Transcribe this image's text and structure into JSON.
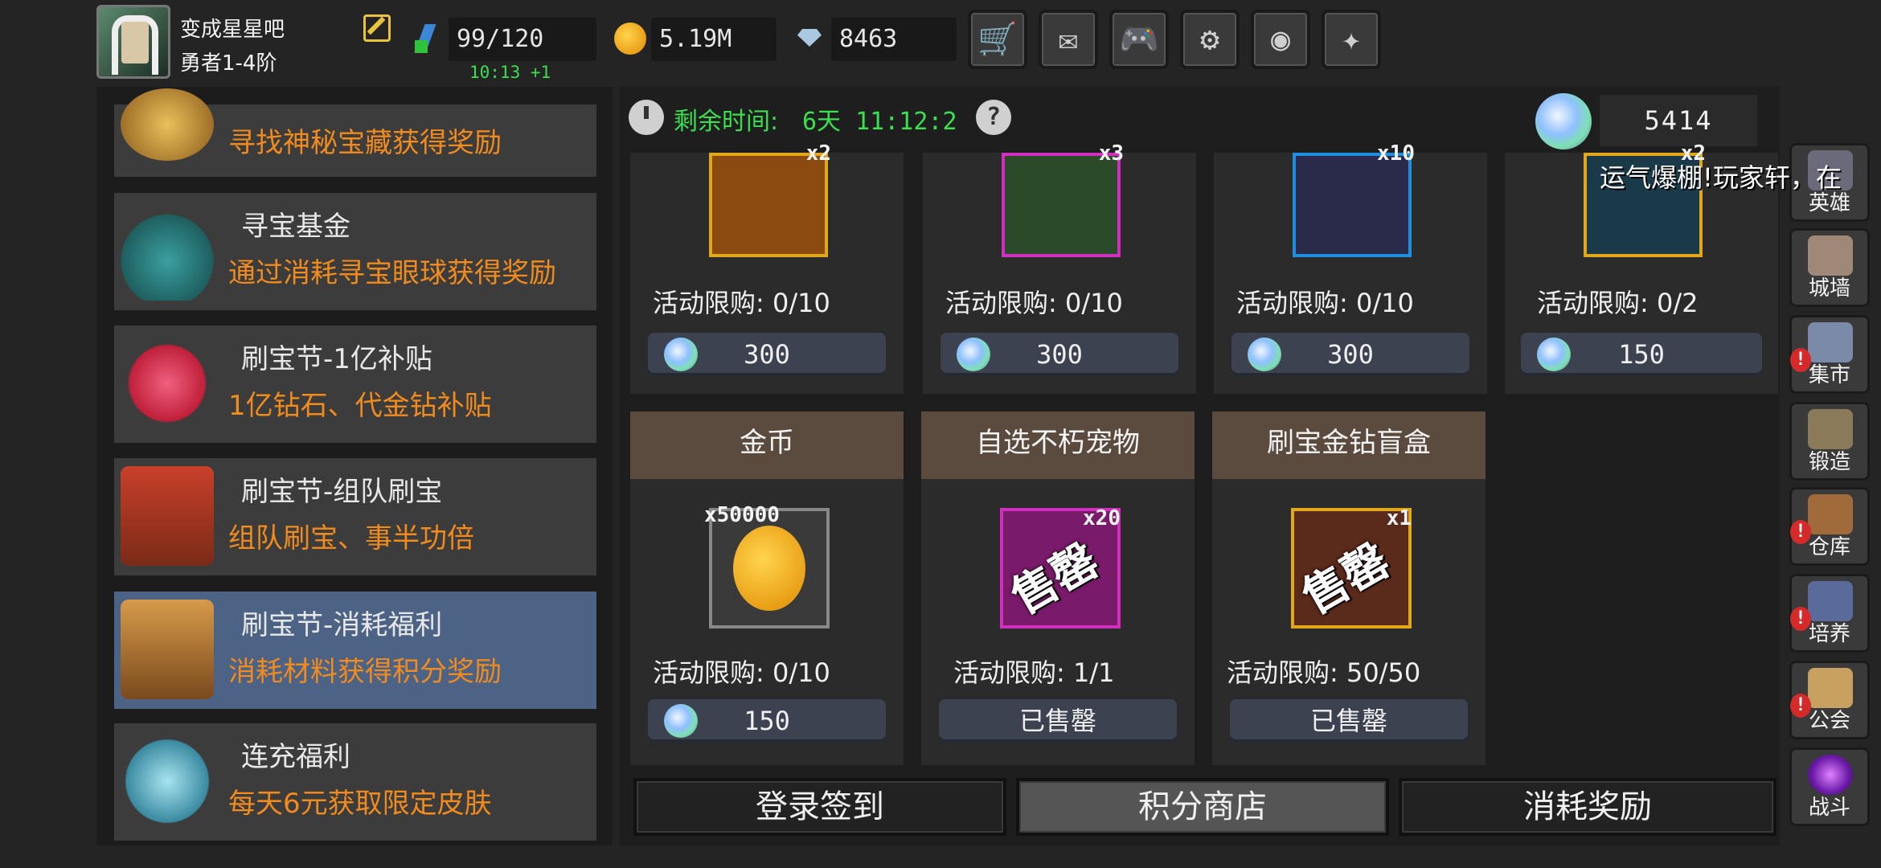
{
  "player": {
    "name": "变成星星吧",
    "rank": "勇者1-4阶"
  },
  "resources": {
    "energy": "99/120",
    "energy_timer": "10:13 +1",
    "gold": "5.19M",
    "diamonds": "8463"
  },
  "top_buttons": [
    {
      "name": "shop",
      "glyph": "🛒"
    },
    {
      "name": "mail",
      "glyph": "✉"
    },
    {
      "name": "gamepad",
      "glyph": "🎮"
    },
    {
      "name": "settings",
      "glyph": "⚙"
    },
    {
      "name": "lens",
      "glyph": "◉"
    },
    {
      "name": "firework",
      "glyph": "✦"
    }
  ],
  "activities": [
    {
      "title": "",
      "desc": "寻找神秘宝藏获得奖励",
      "selected": false
    },
    {
      "title": "寻宝基金",
      "desc": "通过消耗寻宝眼球获得奖励",
      "selected": false
    },
    {
      "title": "刷宝节-1亿补贴",
      "desc": "1亿钻石、代金钻补贴",
      "selected": false
    },
    {
      "title": "刷宝节-组队刷宝",
      "desc": "组队刷宝、事半功倍",
      "selected": false
    },
    {
      "title": "刷宝节-消耗福利",
      "desc": "消耗材料获得积分奖励",
      "selected": true
    },
    {
      "title": "连充福利",
      "desc": "每天6元获取限定皮肤",
      "selected": false
    }
  ],
  "shop": {
    "remaining_label": "剩余时间:",
    "remaining_value": "6天 11:12:2",
    "points": "5414",
    "row1": [
      {
        "qty": "x2",
        "limit": "活动限购: 0/10",
        "price": "300",
        "color": "#e2a81a"
      },
      {
        "qty": "x3",
        "limit": "活动限购: 0/10",
        "price": "300",
        "color": "#d12fc0"
      },
      {
        "qty": "x10",
        "limit": "活动限购: 0/10",
        "price": "300",
        "color": "#1e8fe0"
      },
      {
        "qty": "x2",
        "limit": "活动限购: 0/2",
        "price": "150",
        "color": "#e2a81a"
      }
    ],
    "row2": [
      {
        "name": "金币",
        "qty": "x50000",
        "limit": "活动限购: 0/10",
        "price": "150",
        "sold": false,
        "color": "#888888"
      },
      {
        "name": "自选不朽宠物",
        "qty": "x20",
        "limit": "活动限购: 1/1",
        "price": "已售罄",
        "sold": true,
        "stamp": "售罄",
        "color": "#d12fc0"
      },
      {
        "name": "刷宝金钻盲盒",
        "qty": "x1",
        "limit": "活动限购: 50/50",
        "price": "已售罄",
        "sold": true,
        "stamp": "售罄",
        "color": "#e2a81a"
      }
    ]
  },
  "tabs": [
    {
      "label": "登录签到",
      "active": false
    },
    {
      "label": "积分商店",
      "active": true
    },
    {
      "label": "消耗奖励",
      "active": false
    }
  ],
  "ticker": "运气爆棚!玩家轩，在",
  "side_nav": [
    {
      "label": "英雄",
      "badge": false
    },
    {
      "label": "城墙",
      "badge": false
    },
    {
      "label": "集市",
      "badge": true
    },
    {
      "label": "锻造",
      "badge": false
    },
    {
      "label": "仓库",
      "badge": true
    },
    {
      "label": "培养",
      "badge": true
    },
    {
      "label": "公会",
      "badge": true
    },
    {
      "label": "战斗",
      "badge": false
    }
  ],
  "badge_glyph": "!",
  "colors": {
    "accent_orange": "#f28b1d",
    "timer_green": "#39e050",
    "selected_blue": "#4c6386",
    "card_header": "#5b4a3e"
  }
}
